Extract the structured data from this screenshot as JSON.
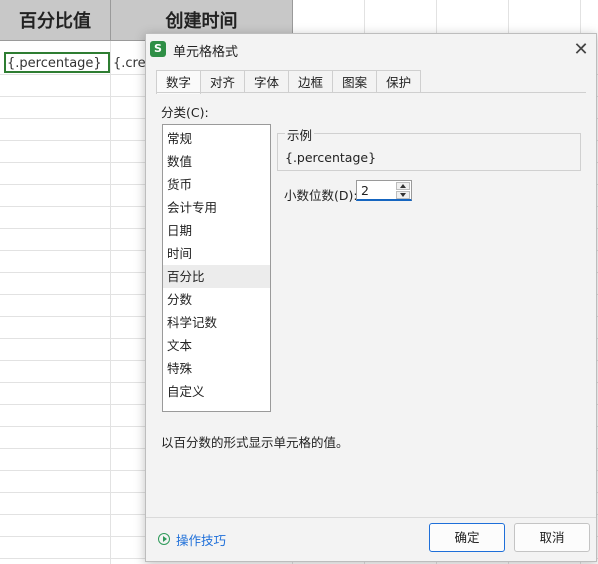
{
  "sheet": {
    "headers": [
      "百分比值",
      "创建时间"
    ],
    "cells": [
      "{.percentage}",
      "{.crea"
    ]
  },
  "dialog": {
    "title": "单元格格式",
    "close_symbol": "✕",
    "tabs": [
      "数字",
      "对齐",
      "字体",
      "边框",
      "图案",
      "保护"
    ],
    "active_tab": "数字",
    "category_label": "分类(C):",
    "categories": [
      "常规",
      "数值",
      "货币",
      "会计专用",
      "日期",
      "时间",
      "百分比",
      "分数",
      "科学记数",
      "文本",
      "特殊",
      "自定义"
    ],
    "selected_category": "百分比",
    "sample_legend": "示例",
    "sample_value": "{.percentage}",
    "decimal_label": "小数位数(D):",
    "decimal_value": "2",
    "description": "以百分数的形式显示单元格的值。",
    "tips_label": "操作技巧",
    "ok_label": "确定",
    "cancel_label": "取消"
  },
  "colors": {
    "selection_border": "#2e7d32",
    "app_icon": "#2f8f46",
    "link": "#1e6fd9",
    "focus_underline": "#1565c0"
  },
  "icons": {
    "app": "wps-spreadsheet-icon",
    "close": "close-icon",
    "tips": "play-circle-icon"
  }
}
